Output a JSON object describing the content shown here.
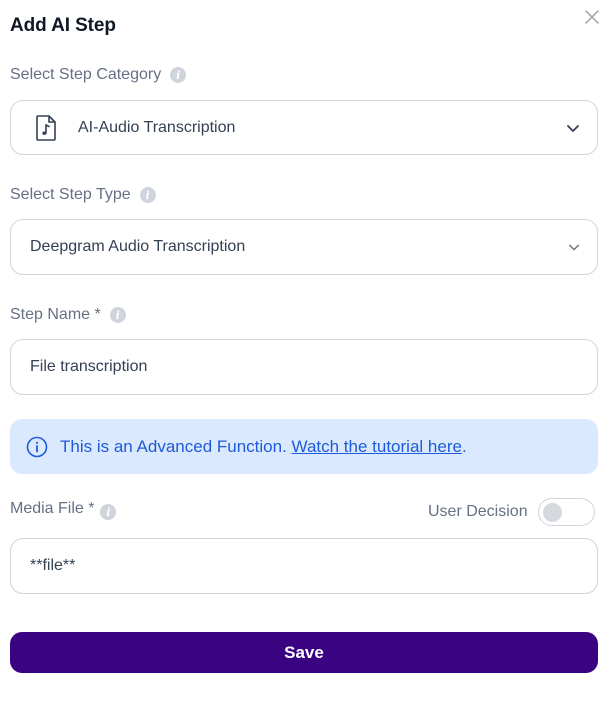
{
  "dialog": {
    "title": "Add AI Step",
    "close_icon": "close-icon"
  },
  "category": {
    "label": "Select Step Category",
    "value": "AI-Audio Transcription",
    "icon": "audio-file-icon"
  },
  "step_type": {
    "label": "Select Step Type",
    "value": "Deepgram Audio Transcription"
  },
  "step_name": {
    "label": "Step Name *",
    "value": "File transcription"
  },
  "banner": {
    "text": "This is an Advanced Function.",
    "link": "Watch the tutorial here",
    "suffix": ".",
    "color": "#1d5bd8",
    "background": "#dbe9fe"
  },
  "media_file": {
    "label": "Media File *",
    "value": "**file**",
    "user_decision_label": "User Decision",
    "user_decision_on": false
  },
  "actions": {
    "save_label": "Save",
    "save_color": "#390382"
  }
}
